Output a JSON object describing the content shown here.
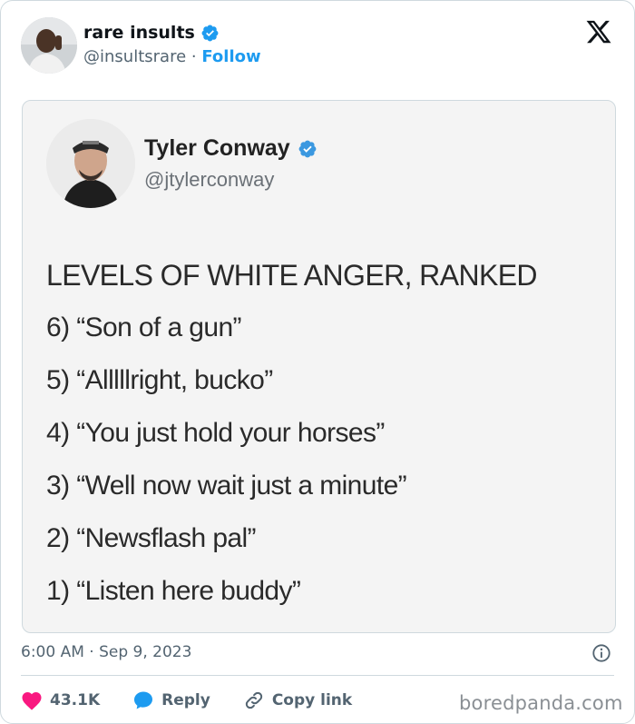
{
  "tweet": {
    "author_name": "rare insults",
    "author_handle": "@insultsrare",
    "separator": "·",
    "follow_label": "Follow",
    "timestamp": "6:00 AM · Sep 9, 2023",
    "likes": "43.1K",
    "reply_label": "Reply",
    "copy_link_label": "Copy link"
  },
  "embedded": {
    "author_name": "Tyler Conway",
    "author_handle": "@jtylerconway",
    "title": "LEVELS OF WHITE ANGER, RANKED",
    "items": [
      "6) “Son of a gun”",
      "5) “Alllllright, bucko”",
      "4) “You just hold your horses”",
      "3) “Well now wait just a minute”",
      "2) “Newsflash pal”",
      "1) “Listen here buddy”"
    ]
  },
  "watermark": "boredpanda.com",
  "icons": {
    "verified": "verified-badge-icon",
    "x_logo": "x-logo-icon",
    "info": "info-icon",
    "heart": "heart-icon",
    "reply": "speech-bubble-icon",
    "link": "link-icon"
  },
  "colors": {
    "brand_blue": "#1d9bf0",
    "like_red": "#f91880",
    "muted_text": "#536471",
    "border": "#cfd9de"
  }
}
